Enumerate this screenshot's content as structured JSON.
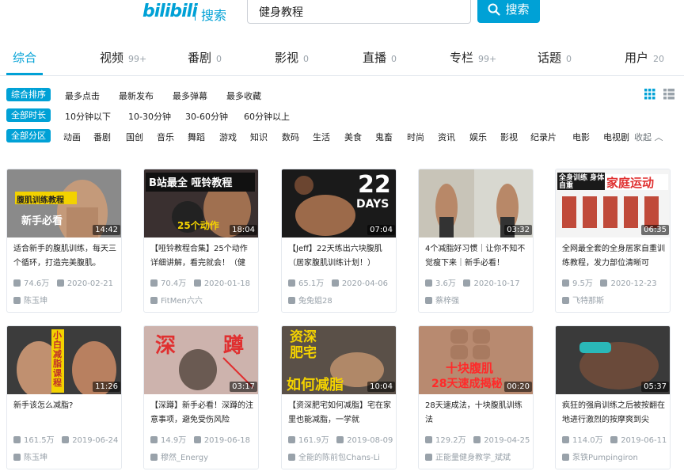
{
  "header": {
    "logo_text": "bilibili",
    "logo_sub": "搜索",
    "search_value": "健身教程",
    "search_button": "搜索"
  },
  "tabs": [
    {
      "label": "综合",
      "count": "",
      "active": true
    },
    {
      "label": "视频",
      "count": "99+"
    },
    {
      "label": "番剧",
      "count": "0"
    },
    {
      "label": "影视",
      "count": "0"
    },
    {
      "label": "直播",
      "count": "0"
    },
    {
      "label": "专栏",
      "count": "99+"
    },
    {
      "label": "话题",
      "count": "0"
    },
    {
      "label": "用户",
      "count": "20"
    }
  ],
  "filters": {
    "sort": {
      "badge": "综合排序",
      "options": [
        "最多点击",
        "最新发布",
        "最多弹幕",
        "最多收藏"
      ]
    },
    "duration": {
      "badge": "全部时长",
      "options": [
        "10分钟以下",
        "10-30分钟",
        "30-60分钟",
        "60分钟以上"
      ]
    },
    "zone": {
      "badge": "全部分区",
      "options": [
        "动画",
        "番剧",
        "国创",
        "音乐",
        "舞蹈",
        "游戏",
        "知识",
        "数码",
        "生活",
        "美食",
        "鬼畜",
        "时尚",
        "资讯",
        "娱乐",
        "影视",
        "纪录片",
        "电影",
        "电视剧"
      ],
      "collapse_label": "收起"
    }
  },
  "colors": {
    "accent": "#00a1d6",
    "muted": "#99a2aa"
  },
  "videos": [
    {
      "thumb_text": "腹肌训练教程",
      "thumb_text2": "新手必看",
      "duration": "14:42",
      "title": "适合新手的腹肌训练，每天三个循环，打造完美腹肌。",
      "views": "74.6万",
      "date": "2020-02-21",
      "author": "陈玉坤"
    },
    {
      "thumb_text": "B站最全 哑铃教程",
      "thumb_text2": "25个动作",
      "duration": "18:04",
      "title": "【哑铃教程合集】25个动作详细讲解，看完就会！（健",
      "views": "70.4万",
      "date": "2020-01-18",
      "author": "FitMen六六"
    },
    {
      "thumb_text": "22",
      "thumb_text2": "DAYS",
      "duration": "07:04",
      "title": "【Jeff】22天练出六块腹肌（居家腹肌训练计划！）",
      "views": "65.1万",
      "date": "2020-04-06",
      "author": "兔兔姐28"
    },
    {
      "thumb_text": "",
      "thumb_text2": "",
      "duration": "03:32",
      "title": "4个减脂好习惯｜让你不知不觉瘦下来｜新手必看！",
      "views": "3.6万",
      "date": "2020-10-17",
      "author": "蔡梓强"
    },
    {
      "thumb_text": "全身训练 身体自重",
      "thumb_text2": "家庭运动",
      "duration": "06:35",
      "title": "全网最全套的全身居家自重训练教程，发力部位清晰可",
      "views": "9.5万",
      "date": "2020-12-23",
      "author": "飞特那斯"
    },
    {
      "thumb_text": "小白减脂课程",
      "thumb_text2": "",
      "duration": "11:26",
      "title": "新手该怎么减脂?",
      "views": "161.5万",
      "date": "2019-06-24",
      "author": "陈玉坤"
    },
    {
      "thumb_text": "深",
      "thumb_text2": "蹲",
      "duration": "03:17",
      "title": "【深蹲】新手必看！深蹲的注意事项，避免受伤风险",
      "views": "14.9万",
      "date": "2019-06-18",
      "author": "穆然_Energy"
    },
    {
      "thumb_text": "资深肥宅",
      "thumb_text2": "如何减脂",
      "duration": "10:04",
      "title": "【资深肥宅如何减脂】宅在家里也能减脂，一学就",
      "views": "161.9万",
      "date": "2019-08-09",
      "author": "全能的陈前包Chans-Li"
    },
    {
      "thumb_text": "十块腹肌",
      "thumb_text2": "28天速成揭秘",
      "duration": "00:20",
      "title": "28天速成法，十块腹肌训练法",
      "views": "129.2万",
      "date": "2019-04-25",
      "author": "正能量健身教学_斌斌"
    },
    {
      "thumb_text": "",
      "thumb_text2": "",
      "duration": "05:37",
      "title": "疯狂的强肩训练之后被按翻在地进行激烈的按摩爽到尖",
      "views": "114.0万",
      "date": "2019-06-11",
      "author": "泵铁Pumpingiron"
    }
  ]
}
